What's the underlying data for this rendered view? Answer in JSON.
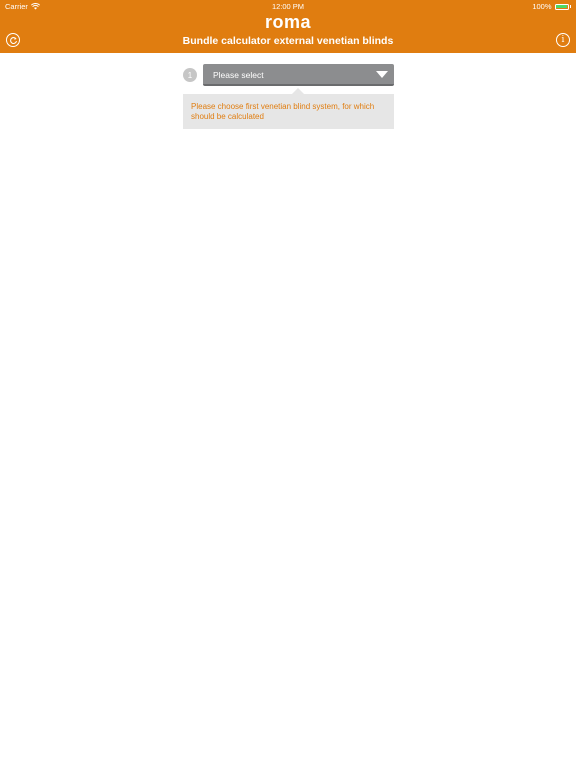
{
  "status_bar": {
    "carrier": "Carrier",
    "time": "12:00 PM",
    "battery_percent": "100%",
    "battery_level": 1.0,
    "icons": [
      "wifi-icon",
      "battery-icon"
    ]
  },
  "header": {
    "logo_text": "roma",
    "title": "Bundle calculator external venetian blinds",
    "background_color": "#e07d10",
    "left_icon": "refresh-icon",
    "right_icon": "info-icon"
  },
  "step": {
    "number": "1",
    "select_placeholder": "Please select",
    "hint": "Please choose first venetian blind system, for which should be calculated"
  }
}
